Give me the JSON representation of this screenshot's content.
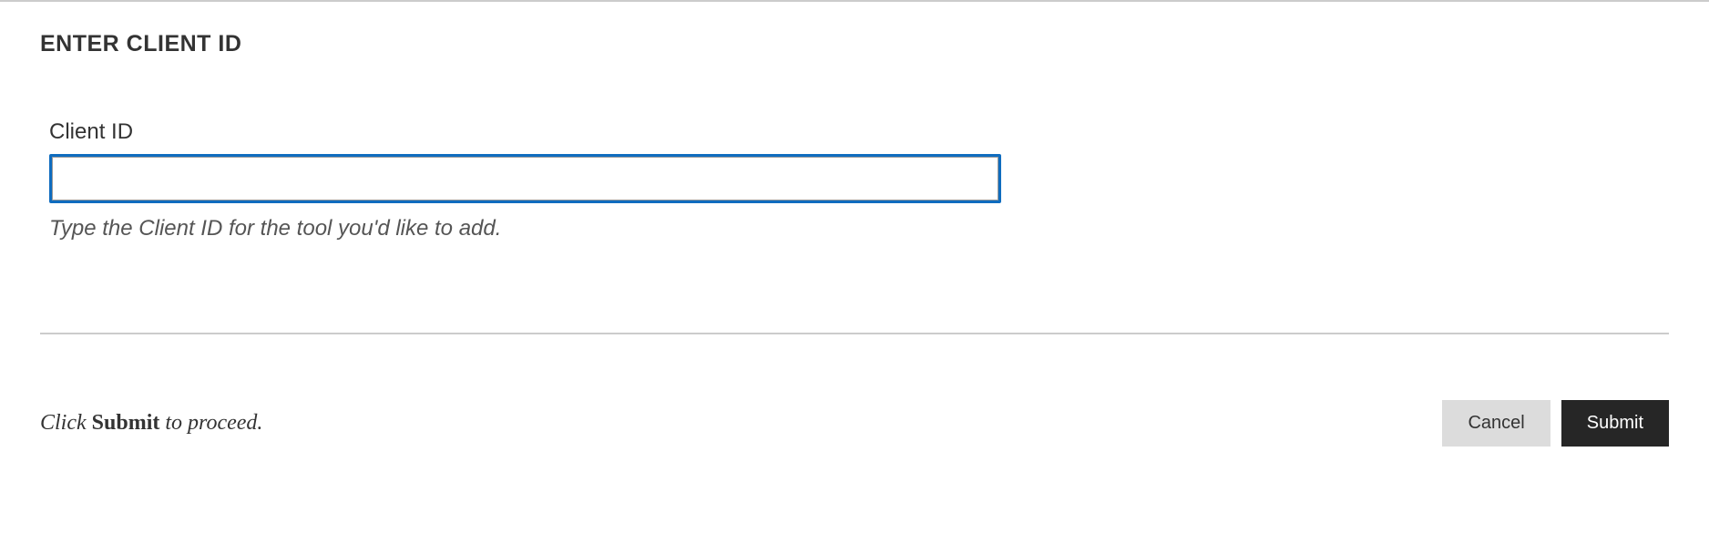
{
  "section": {
    "heading": "ENTER CLIENT ID"
  },
  "form": {
    "client_id": {
      "label": "Client ID",
      "value": "",
      "help": "Type the Client ID for the tool you'd like to add."
    }
  },
  "footer": {
    "instruction_prefix": "Click ",
    "instruction_bold": "Submit",
    "instruction_suffix": " to proceed.",
    "cancel_label": "Cancel",
    "submit_label": "Submit"
  }
}
